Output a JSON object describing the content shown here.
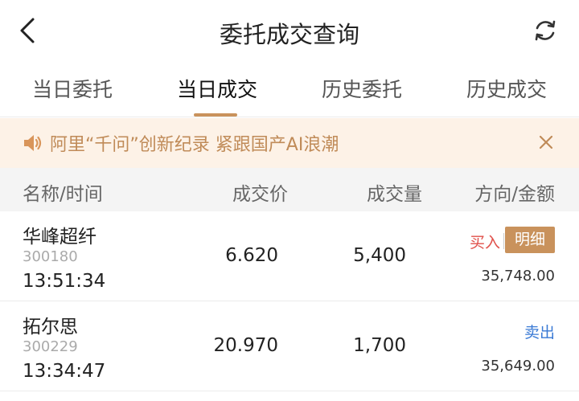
{
  "header": {
    "title": "委托成交查询",
    "back_icon": "back-arrow-icon",
    "refresh_icon": "refresh-icon"
  },
  "tabs": [
    {
      "label": "当日委托",
      "active": false
    },
    {
      "label": "当日成交",
      "active": true
    },
    {
      "label": "历史委托",
      "active": false
    },
    {
      "label": "历史成交",
      "active": false
    }
  ],
  "notice": {
    "text": "阿里“千问”创新纪录 紧跟国产AI浪潮",
    "icon": "speaker-icon",
    "close_icon": "close-icon"
  },
  "table": {
    "headers": {
      "name_time": "名称/时间",
      "price": "成交价",
      "volume": "成交量",
      "direction_amount": "方向/金额"
    },
    "rows": [
      {
        "name": "华峰超纤",
        "code": "300180",
        "time": "13:51:34",
        "price": "6.620",
        "volume": "5,400",
        "direction": "买入",
        "detail_label": "明细",
        "amount": "35,748.00"
      },
      {
        "name": "拓尔思",
        "code": "300229",
        "time": "13:34:47",
        "price": "20.970",
        "volume": "1,700",
        "direction": "卖出",
        "amount": "35,649.00"
      }
    ]
  },
  "colors": {
    "accent": "#c9925c",
    "buy": "#e0504a",
    "sell": "#3a7ad5",
    "notice_bg": "#fdf2e7"
  }
}
